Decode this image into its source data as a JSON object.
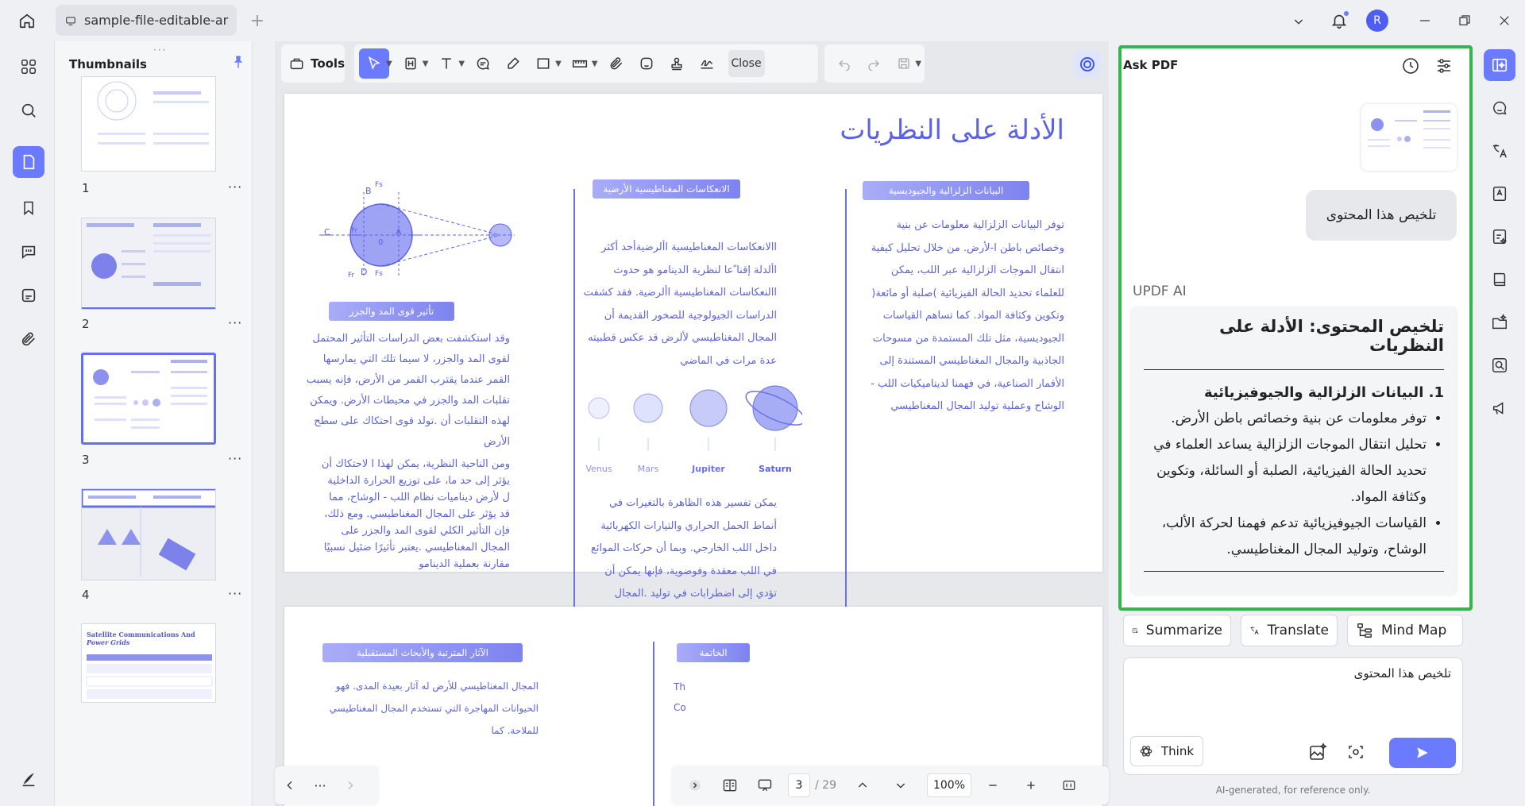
{
  "titlebar": {
    "tab_title": "sample-file-editable-ar",
    "avatar_letter": "R"
  },
  "thumbnails": {
    "title": "Thumbnails",
    "pages": [
      "1",
      "2",
      "3",
      "4"
    ],
    "more": "···",
    "page5_title_plain": "Satellite Communications And ",
    "page5_title_italic": "Power Grids"
  },
  "toolbar": {
    "tools_label": "Tools",
    "close_label": "Close"
  },
  "page3": {
    "title": "الأدلة على النظريات",
    "col1_header": "البيانات الزلزالية والجيوديسية",
    "col1_text": "توفر البيانات الزلزالية معلومات عن بنية وخصائص باطن ا-لأرض. من خلال تحليل كيفية  انتقال الموجات الزلزالية عبر اللب، يمكن للعلماء  تحديد  الحالة الفيزيائية )صلبة أو مائعة( وتكوين وكثافة  المواد. كما تساهم القياسات الجيوديسية، مثل تلك  المستمدة من مسوحات الجاذبية والمجال المغناطيسي المستندة إلى الأقمار الصناعية، في فهمنا لديناميكيات  اللب - الوشاح وعملية توليد المجال المغناطيسي",
    "col2_header": "الانعكاسات المغناطيسية الأرضية",
    "col2_text": "االانعكاسات المغناطيسية األرضيةأحد أكثر األدلة  إقنا ًعا لنظرية الدينامو هو حدوث االنعكاسات   المغناطيسية األرضية. فقد كشفت الدراسات   الجيولوجية للصخور القديمة أن المجال المغناطيسي  لألرض قد عكس قطبيته عدة مرات في الماضي",
    "planets": [
      "Venus",
      "Mars",
      "Jupiter",
      "Saturn"
    ],
    "col2_text2": "يمكن تفسير هذه الظاهرة بالتغيرات في أنماط الحمل الحراري    والتيارات الكهربائية داخل اللب الخارجي. وبما أن حركات الموائع في    اللب معقدة وفوضوية، فإنها يمكن أن تؤدي إلى اضطرابات في توليد .المجال المغناطيسي، مما يسبب انعكاسات",
    "col3_header": "تأثير قوى المد والجزر",
    "col3_text": "وقد استكشفت بعض الدراسات التأثير المحتمل  لقوى المد والجزر، لا سيما تلك التي يمارسها القمر عندما يقترب القمر من الأرض، فإنه يسبب تقلبات المد  والجزر في محيطات الأرض. ويمكن لهذه التقلبات أن .تولد قوى احتكاك على سطح الأرض",
    "col3_text2": "ومن الناحية النظرية، يمكن لهذا ا لاحتكاك أن يؤثر إلى حد ما، على توزيع الحرارة الداخلية ل  لأرض ديناميات نظام اللب - الوشاح، مما قد يؤثر على المجال المغناطيسي. ومع ذلك، فإن التأثير الكلي لقوى المد والجزر على المجال المغناطيسي  .يعتبر تأثيرًا ضئيل نسبيًا مقارنة بعملية الدينامو",
    "diagram_labels": [
      "B",
      "A",
      "C",
      "D",
      "0",
      "Fr",
      "Fs",
      "Fr",
      "Fs"
    ]
  },
  "page4": {
    "header_right": "الخاتمة",
    "header_left": "الآثار المترتبة والأبحاث المستقبلية",
    "text_left_1": "المجال المغناطيسي للأرض له آثار بعيدة المدى. فهو",
    "text_left_2": "الحيوانات المهاجرة التي تستخدم المجال المغناطيسي للملاحة. كما",
    "text_right_1": "Th",
    "text_right_2": "Co"
  },
  "bottomnav": {
    "page_current": "3",
    "page_total": "/ 29",
    "zoom": "100%"
  },
  "askpdf": {
    "title": "Ask PDF",
    "user_msg": "تلخيص هذا المحتوى",
    "ai_label": "UPDF AI",
    "summary_title": "تلخيص المحتوى: الأدلة على النظريات",
    "section1": "1. البيانات الزلزالية والجيوفيزيائية",
    "bullets": [
      "توفر معلومات عن بنية وخصائص باطن الأرض.",
      "تحليل انتقال الموجات الزلزالية يساعد العلماء في تحديد الحالة الفيزيائية، الصلبة أو السائلة، وتكوين وكثافة المواد.",
      "القياسات الجيوفيزيائية تدعم فهمنا لحركة الألب، الوشاح، وتوليد المجال المغناطيسي."
    ],
    "summarize": "Summarize",
    "translate": "Translate",
    "mindmap": "Mind Map",
    "input_value": "تلخيص هذا المحتوى",
    "think": "Think",
    "footer": "AI-generated, for reference only."
  },
  "colors": {
    "accent": "#6b7bff",
    "highlight": "#2fb84c",
    "doc_blue": "#5c63d9"
  }
}
